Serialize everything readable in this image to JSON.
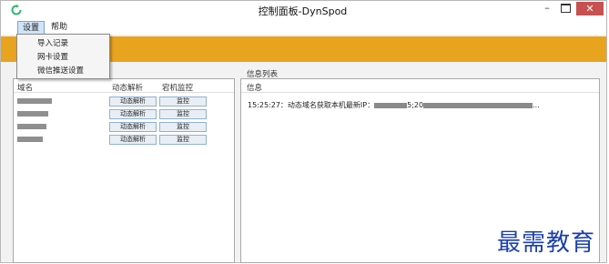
{
  "window": {
    "title": "控制面板-DynSpod",
    "controls": {
      "minimize": "–",
      "close": "✕"
    }
  },
  "menu": {
    "settings": "设置",
    "help": "帮助",
    "dropdown": [
      "导入记录",
      "网卡设置",
      "微信推送设置"
    ]
  },
  "left_panel": {
    "columns": [
      "域名",
      "动态解析",
      "宕机监控"
    ],
    "rows": [
      {
        "resolve_label": "动态解析",
        "monitor_label": "监控"
      },
      {
        "resolve_label": "动态解析",
        "monitor_label": "监控"
      },
      {
        "resolve_label": "动态解析",
        "monitor_label": "监控"
      },
      {
        "resolve_label": "动态解析",
        "monitor_label": "监控"
      }
    ]
  },
  "right_panel": {
    "title": "信息列表",
    "column": "信息",
    "log_prefix": "15:25:27：动态域名获取本机最新IP：",
    "log_mid": "5;20",
    "log_suffix": "..."
  },
  "watermark": "最需教育",
  "colors": {
    "banner": "#e8a31f",
    "close": "#c75050",
    "icon": "#2bb673",
    "watermark": "#1c3fae"
  },
  "icons": {
    "app": "refresh-circle-icon"
  }
}
